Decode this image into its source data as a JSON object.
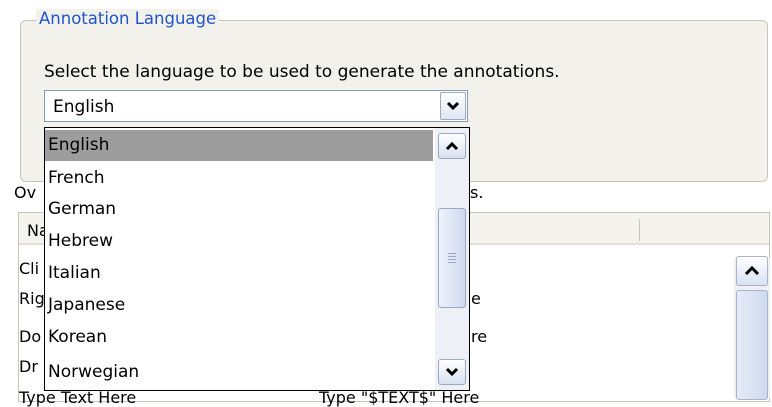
{
  "group": {
    "title": "Annotation Language",
    "description": "Select the language to be used to generate the annotations."
  },
  "combo": {
    "value": "English"
  },
  "dropdown": {
    "options": [
      "English",
      "French",
      "German",
      "Hebrew",
      "Italian",
      "Japanese",
      "Korean",
      "Norwegian"
    ],
    "selected": "English"
  },
  "background": {
    "overview_label_head": "Ov",
    "overview_label_tail": "s.",
    "table_header_name": "Na",
    "rows": [
      {
        "left": "Cli",
        "right": ""
      },
      {
        "left": "Rig",
        "right": "e"
      },
      {
        "left": "Do",
        "right": "re"
      },
      {
        "left": "Dr",
        "right": ""
      },
      {
        "left": "Type Text Here",
        "right": "Type \"$TEXT$\" Here"
      }
    ]
  },
  "icons": {
    "combo_button": "chevron-down-icon",
    "scroll_up": "chevron-up-icon",
    "scroll_down": "chevron-down-icon",
    "thumb_grip": "grip-icon"
  }
}
